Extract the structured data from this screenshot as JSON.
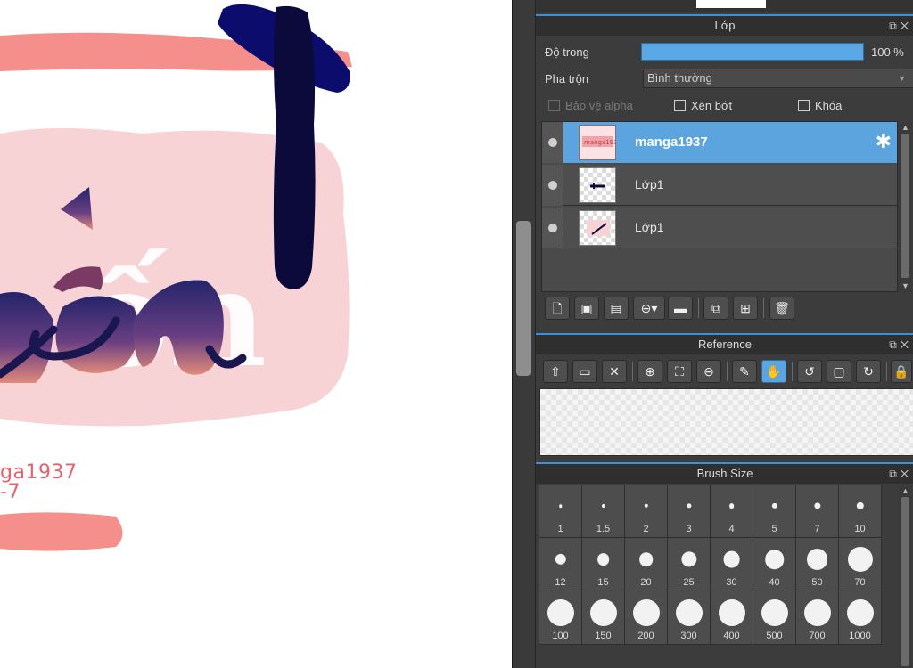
{
  "canvas": {
    "partial_text_line1": "ga1937",
    "partial_text_line2": "-7"
  },
  "layer_panel": {
    "title": "Lớp",
    "opacity_label": "Độ trong",
    "opacity_value": "100 %",
    "opacity_fraction": 1.0,
    "blend_label": "Pha trộn",
    "blend_value": "Bình thường",
    "protect_alpha_label": "Bảo vệ alpha",
    "clipping_label": "Xén bớt",
    "lock_label": "Khóa",
    "layers": [
      {
        "name": "manga1937",
        "selected": true
      },
      {
        "name": "Lớp1",
        "selected": false
      },
      {
        "name": "Lớp1",
        "selected": false
      }
    ],
    "toolbar_icons": [
      "new-layer-icon",
      "new-8bit-layer-icon",
      "new-1bit-layer-icon",
      "add-layer-menu-icon",
      "folder-icon",
      "duplicate-layer-icon",
      "merge-layer-icon",
      "delete-layer-icon"
    ]
  },
  "reference_panel": {
    "title": "Reference",
    "toolbar_icons": [
      "upload-icon",
      "open-folder-icon",
      "close-icon",
      "zoom-in-icon",
      "fit-icon",
      "zoom-out-icon",
      "eyedropper-icon",
      "hand-icon",
      "rotate-left-icon",
      "fullscreen-icon",
      "rotate-right-icon",
      "lock-icon"
    ]
  },
  "brush_size_panel": {
    "title": "Brush Size",
    "sizes": [
      {
        "label": "1",
        "value": 1
      },
      {
        "label": "1.5",
        "value": 1.5
      },
      {
        "label": "2",
        "value": 2
      },
      {
        "label": "3",
        "value": 3
      },
      {
        "label": "4",
        "value": 4
      },
      {
        "label": "5",
        "value": 5
      },
      {
        "label": "7",
        "value": 7
      },
      {
        "label": "10",
        "value": 10
      },
      {
        "label": "12",
        "value": 12
      },
      {
        "label": "15",
        "value": 15
      },
      {
        "label": "20",
        "value": 20
      },
      {
        "label": "25",
        "value": 25
      },
      {
        "label": "30",
        "value": 30
      },
      {
        "label": "40",
        "value": 40
      },
      {
        "label": "50",
        "value": 50
      },
      {
        "label": "70",
        "value": 70
      },
      {
        "label": "100",
        "value": 100
      },
      {
        "label": "150",
        "value": 150
      },
      {
        "label": "200",
        "value": 200
      },
      {
        "label": "300",
        "value": 300
      },
      {
        "label": "400",
        "value": 400
      },
      {
        "label": "500",
        "value": 500
      },
      {
        "label": "700",
        "value": 700
      },
      {
        "label": "1000",
        "value": 1000
      }
    ]
  },
  "colors": {
    "accent": "#5ba4dd",
    "panel_bg": "#3c3c3c",
    "canvas_pink": "#f7cfd3",
    "stroke_salmon": "#f58f8c",
    "stroke_navy": "#0c0a3a"
  }
}
